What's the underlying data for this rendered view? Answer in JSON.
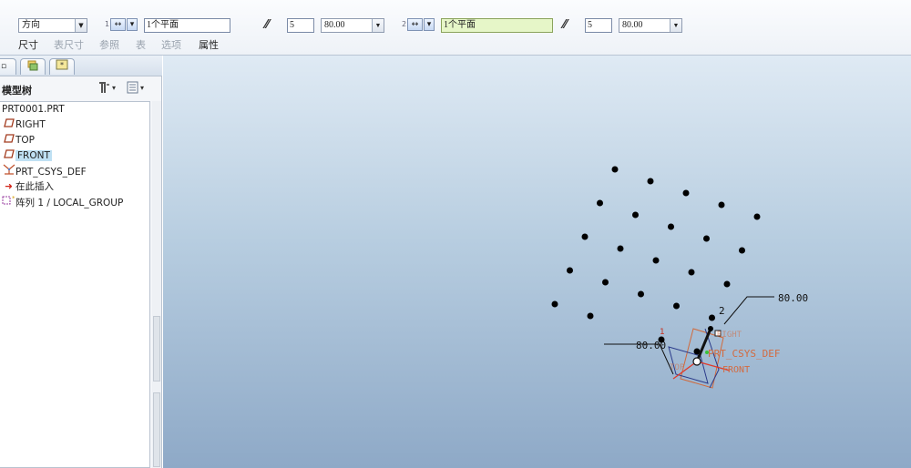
{
  "dashboard": {
    "direction_label": "方向",
    "dir1": {
      "index": "1",
      "reference": "1个平面",
      "count": "5",
      "increment": "80.00"
    },
    "dir2": {
      "index": "2",
      "reference": "1个平面",
      "count": "5",
      "increment": "80.00"
    },
    "tabs": [
      {
        "label": "尺寸",
        "enabled": true
      },
      {
        "label": "表尺寸",
        "enabled": false
      },
      {
        "label": "参照",
        "enabled": false
      },
      {
        "label": "表",
        "enabled": false
      },
      {
        "label": "选项",
        "enabled": false
      },
      {
        "label": "属性",
        "enabled": true
      }
    ]
  },
  "tree": {
    "title": "模型树",
    "items": [
      {
        "label": "PRT0001.PRT",
        "icon": "part-icon"
      },
      {
        "label": "RIGHT",
        "icon": "datum-plane-icon"
      },
      {
        "label": "TOP",
        "icon": "datum-plane-icon"
      },
      {
        "label": "FRONT",
        "icon": "datum-plane-icon",
        "selected": true
      },
      {
        "label": "PRT_CSYS_DEF",
        "icon": "csys-icon"
      },
      {
        "label": "在此插入",
        "icon": "insert-arrow-icon"
      },
      {
        "label": "阵列 1 / LOCAL_GROUP",
        "icon": "pattern-icon"
      }
    ]
  },
  "viewport": {
    "dim1_value": "80.00",
    "dim2_value": "80.00",
    "dir1_marker": "1",
    "dir2_marker": "2",
    "csys_label": "PRT_CSYS_DEF",
    "front_label": "FRONT",
    "right_label": "RIGHT",
    "top_label": "TOP",
    "colors": {
      "points": "#000000",
      "datum": "#e05a3a",
      "dim": "#111111"
    }
  }
}
